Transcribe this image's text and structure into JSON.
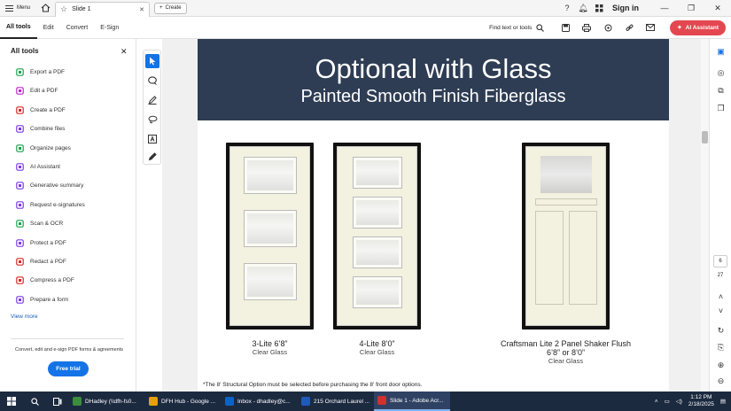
{
  "topbar": {
    "menu_label": "Menu",
    "tab_title": "Slide 1",
    "create_label": "Create",
    "signin_label": "Sign in"
  },
  "toolbar": {
    "tabs": [
      "All tools",
      "Edit",
      "Convert",
      "E-Sign"
    ],
    "find_label": "Find text or tools",
    "ai_label": "AI Assistant"
  },
  "leftpanel": {
    "title": "All tools",
    "items": [
      {
        "label": "Export a PDF",
        "icon": "export-pdf-icon",
        "color": "#16a34a"
      },
      {
        "label": "Edit a PDF",
        "icon": "edit-pdf-icon",
        "color": "#c026d3"
      },
      {
        "label": "Create a PDF",
        "icon": "create-pdf-icon",
        "color": "#dc2626"
      },
      {
        "label": "Combine files",
        "icon": "combine-files-icon",
        "color": "#7c3aed"
      },
      {
        "label": "Organize pages",
        "icon": "organize-pages-icon",
        "color": "#16a34a"
      },
      {
        "label": "AI Assistant",
        "icon": "ai-assistant-icon",
        "color": "#7c3aed"
      },
      {
        "label": "Generative summary",
        "icon": "summary-icon",
        "color": "#7c3aed"
      },
      {
        "label": "Request e-signatures",
        "icon": "esign-icon",
        "color": "#7c3aed"
      },
      {
        "label": "Scan & OCR",
        "icon": "scan-icon",
        "color": "#16a34a"
      },
      {
        "label": "Protect a PDF",
        "icon": "protect-icon",
        "color": "#7c3aed"
      },
      {
        "label": "Redact a PDF",
        "icon": "redact-icon",
        "color": "#dc2626"
      },
      {
        "label": "Compress a PDF",
        "icon": "compress-icon",
        "color": "#dc2626"
      },
      {
        "label": "Prepare a form",
        "icon": "form-icon",
        "color": "#7c3aed"
      }
    ],
    "view_more": "View more",
    "promo": "Convert, edit and e-sign PDF forms & agreements",
    "trial": "Free trial"
  },
  "document": {
    "title": "Optional with Glass",
    "subtitle": "Painted Smooth Finish Fiberglass",
    "doors": [
      {
        "name": "3-Lite 6’8”",
        "glass": "Clear Glass"
      },
      {
        "name": "4-Lite 8’0”",
        "glass": "Clear Glass"
      },
      {
        "name": "Craftsman Lite 2 Panel Shaker Flush",
        "size": "6’8” or 8’0”",
        "glass": "Clear Glass"
      }
    ],
    "footnote": "*The 8' Structural Option must be selected before purchasing the 8' front door options."
  },
  "pager": {
    "current": "6",
    "total": "27"
  },
  "taskbar": {
    "apps": [
      {
        "label": "DHadley (\\\\dfh-fs0...",
        "color": "#3b8e3b"
      },
      {
        "label": "DFH Hub - Google ...",
        "color": "#e5a00d"
      },
      {
        "label": "Inbox - dhadley@c...",
        "color": "#0a64c8"
      },
      {
        "label": "215 Orchard Laurel ...",
        "color": "#1e5bb8"
      },
      {
        "label": "Slide 1 - Adobe Acr...",
        "color": "#d32f2f"
      }
    ],
    "time": "1:12 PM",
    "date": "2/18/2025"
  },
  "colors": {
    "header_bg": "#2e3d54",
    "accent": "#1473e6",
    "ai_button": "#e34850"
  }
}
